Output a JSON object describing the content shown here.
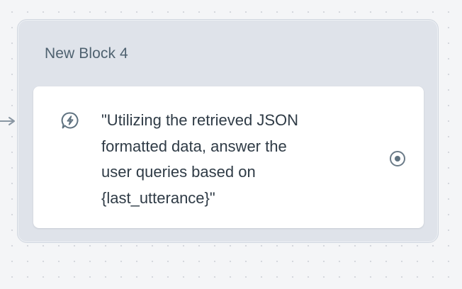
{
  "block": {
    "title": "New Block 4",
    "steps": [
      {
        "icon": "lightning-bubble-icon",
        "text": "\"Utilizing the retrieved JSON\nformatted data, answer the\nuser queries based on\n{last_utterance}\"",
        "port_icon": "radio-dot-icon"
      }
    ]
  },
  "connector_icon": "incoming-arrow-icon",
  "colors": {
    "canvas_bg": "#f4f5f7",
    "block_bg": "#dfe3ea",
    "card_bg": "#ffffff",
    "title_text": "#4f6270",
    "body_text": "#2f3b46",
    "icon_stroke": "#5f7280"
  }
}
